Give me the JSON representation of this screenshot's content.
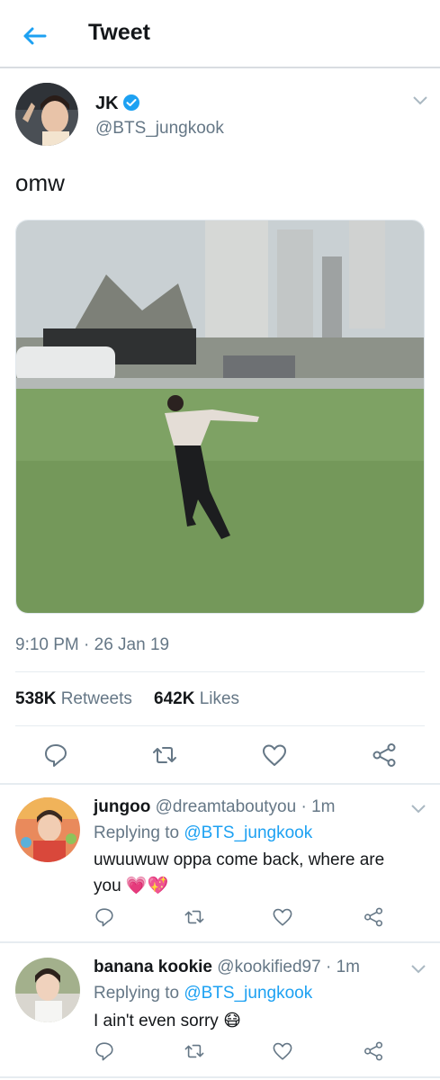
{
  "header": {
    "title": "Tweet",
    "back_icon": "arrow-left-icon"
  },
  "tweet": {
    "author_name": "JK",
    "verified_icon": "verified-badge-icon",
    "author_handle": "@BTS_jungkook",
    "text": "omw",
    "timestamp": "9:10 PM · 26 Jan 19",
    "retweets_count": "538K",
    "retweets_label": "Retweets",
    "likes_count": "642K",
    "likes_label": "Likes",
    "actions": [
      "reply-icon",
      "retweet-icon",
      "like-icon",
      "share-icon"
    ]
  },
  "replies": [
    {
      "name": "jungoo",
      "handle": "@dreamtaboutyou",
      "time": "· 1m",
      "replying_prefix": "Replying to",
      "replying_to": "@BTS_jungkook",
      "text_line1": "uwuuwuw oppa come back, where are",
      "text_line2": "you",
      "emoji": "💗💖"
    },
    {
      "name": "banana kookie",
      "handle": "@kookified97",
      "time": "· 1m",
      "replying_prefix": "Replying to",
      "replying_to": "@BTS_jungkook",
      "text_line1": "I ain't even sorry",
      "emoji": "😷"
    }
  ],
  "colors": {
    "accent": "#1da1f2",
    "secondary_text": "#657786",
    "divider": "#e6ecf0"
  }
}
